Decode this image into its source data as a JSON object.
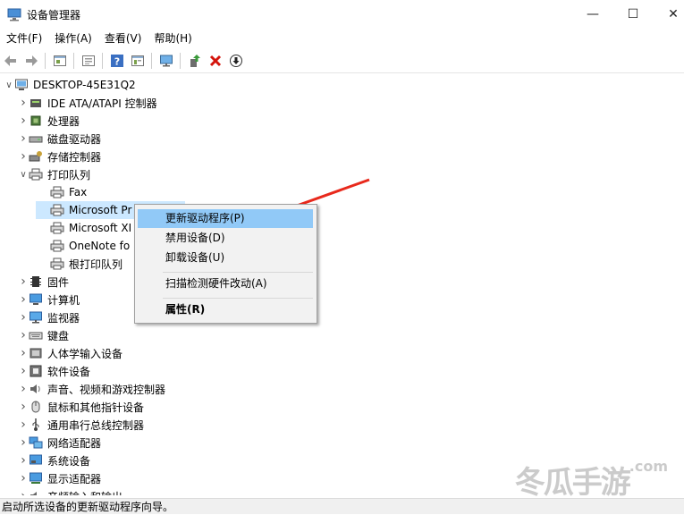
{
  "window": {
    "title": "设备管理器",
    "minimize": "—",
    "maximize": "☐",
    "close": "✕"
  },
  "menu": [
    "文件(F)",
    "操作(A)",
    "查看(V)",
    "帮助(H)"
  ],
  "toolbar": {
    "icons": [
      "back-icon",
      "forward-icon",
      "properties-icon",
      "show-hide-icon",
      "help-icon",
      "details-icon",
      "monitor-icon",
      "update-driver-icon",
      "uninstall-icon",
      "download-icon"
    ]
  },
  "tree": {
    "root": "DESKTOP-45E31Q2",
    "items": [
      {
        "label": "IDE ATA/ATAPI 控制器",
        "icon": "ide-controller-icon",
        "expanded": false
      },
      {
        "label": "处理器",
        "icon": "processor-icon",
        "expanded": false
      },
      {
        "label": "磁盘驱动器",
        "icon": "disk-drive-icon",
        "expanded": false
      },
      {
        "label": "存储控制器",
        "icon": "storage-controller-icon",
        "expanded": false
      },
      {
        "label": "打印队列",
        "icon": "printer-icon",
        "expanded": true,
        "children": [
          "Fax",
          "Microsoft Pr",
          "Microsoft XI",
          "OneNote fo",
          "根打印队列"
        ]
      },
      {
        "label": "固件",
        "icon": "firmware-icon",
        "expanded": false
      },
      {
        "label": "计算机",
        "icon": "computer-icon",
        "expanded": false
      },
      {
        "label": "监视器",
        "icon": "monitor-icon",
        "expanded": false
      },
      {
        "label": "键盘",
        "icon": "keyboard-icon",
        "expanded": false
      },
      {
        "label": "人体学输入设备",
        "icon": "hid-icon",
        "expanded": false
      },
      {
        "label": "软件设备",
        "icon": "software-device-icon",
        "expanded": false
      },
      {
        "label": "声音、视频和游戏控制器",
        "icon": "speaker-icon",
        "expanded": false
      },
      {
        "label": "鼠标和其他指针设备",
        "icon": "mouse-icon",
        "expanded": false
      },
      {
        "label": "通用串行总线控制器",
        "icon": "usb-icon",
        "expanded": false
      },
      {
        "label": "网络适配器",
        "icon": "network-adapter-icon",
        "expanded": false
      },
      {
        "label": "系统设备",
        "icon": "system-device-icon",
        "expanded": false
      },
      {
        "label": "显示适配器",
        "icon": "display-adapter-icon",
        "expanded": false
      },
      {
        "label": "音频输入和输出",
        "icon": "audio-io-icon",
        "expanded": false
      }
    ]
  },
  "context_menu": {
    "update_driver": "更新驱动程序(P)",
    "disable_device": "禁用设备(D)",
    "uninstall_device": "卸载设备(U)",
    "scan_hardware": "扫描检测硬件改动(A)",
    "properties": "属性(R)"
  },
  "status": {
    "text": "启动所选设备的更新驱动程序向导。"
  },
  "watermark": {
    "text": "冬瓜手游",
    "suffix": ".com"
  },
  "colors": {
    "highlight": "#91c9f7",
    "arrow": "#e8291c"
  }
}
